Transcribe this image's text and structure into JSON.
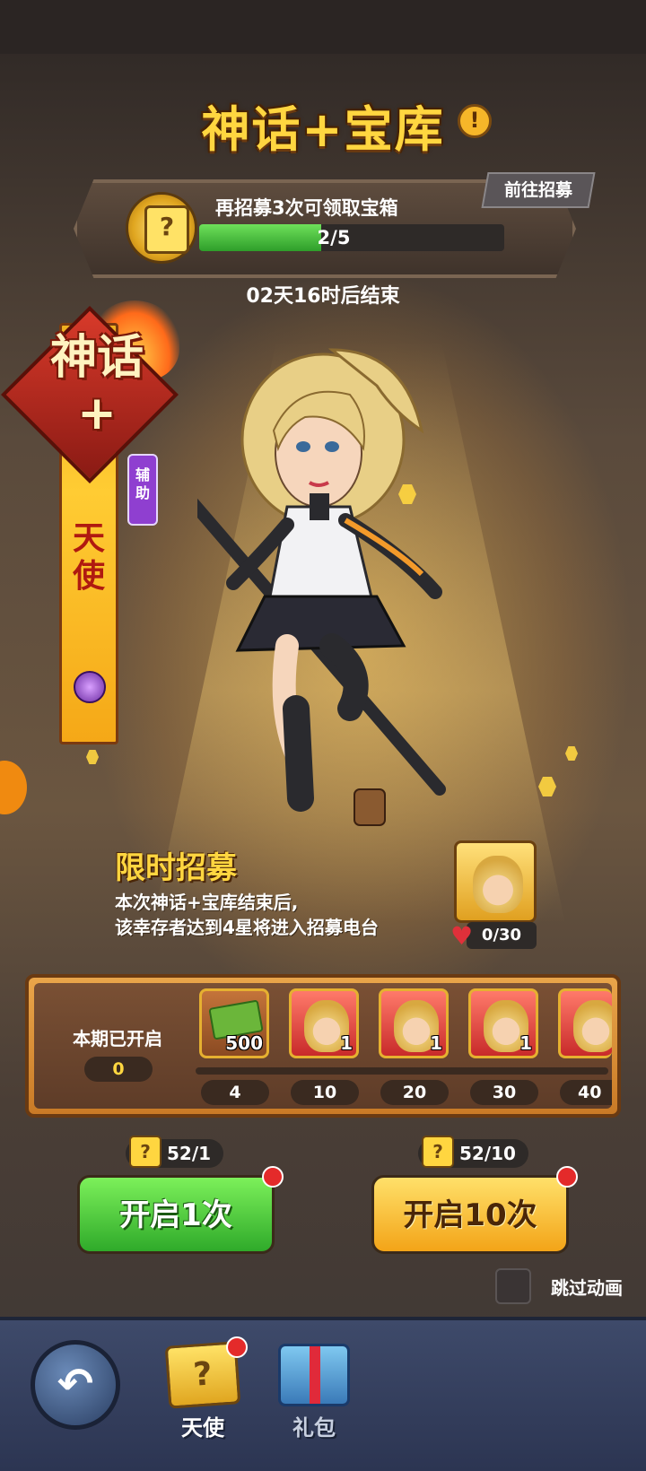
{
  "header": {
    "title": "神话+宝库",
    "info_icon": "!"
  },
  "progress": {
    "goto_label": "前往招募",
    "label": "再招募3次可领取宝箱",
    "current": 2,
    "total": 5,
    "text": "2/5",
    "timer": "02天16时后结束"
  },
  "hero": {
    "rarity_label": "神话+",
    "name": "天使",
    "role": "辅助"
  },
  "limited": {
    "title": "限时招募",
    "desc_line1": "本次神话+宝库结束后,",
    "desc_line2": "该幸存者达到4星将进入招募电台",
    "fragments": "0/30"
  },
  "milestones": {
    "opened_label": "本期已开启",
    "opened_count": "0",
    "rewards": [
      {
        "type": "cash",
        "qty": "500",
        "threshold": "4"
      },
      {
        "type": "fragment",
        "qty": "1",
        "threshold": "10"
      },
      {
        "type": "fragment",
        "qty": "1",
        "threshold": "20"
      },
      {
        "type": "fragment",
        "qty": "1",
        "threshold": "30"
      },
      {
        "type": "fragment",
        "qty": "",
        "threshold": "40"
      }
    ]
  },
  "actions": {
    "single": {
      "cost": "52/1",
      "label": "开启1次"
    },
    "ten": {
      "cost": "52/10",
      "label": "开启10次"
    },
    "skip_label": "跳过动画"
  },
  "bottom_nav": {
    "tabs": [
      {
        "label": "天使",
        "icon": "mystery-chest-icon",
        "active": true
      },
      {
        "label": "礼包",
        "icon": "gift-box-icon",
        "active": false
      }
    ]
  },
  "colors": {
    "accent_gold": "#ffd640",
    "progress_green": "#2e9e2a",
    "button_green": "#2faa2a",
    "button_gold": "#f3a418",
    "notify_red": "#e42a2a"
  }
}
